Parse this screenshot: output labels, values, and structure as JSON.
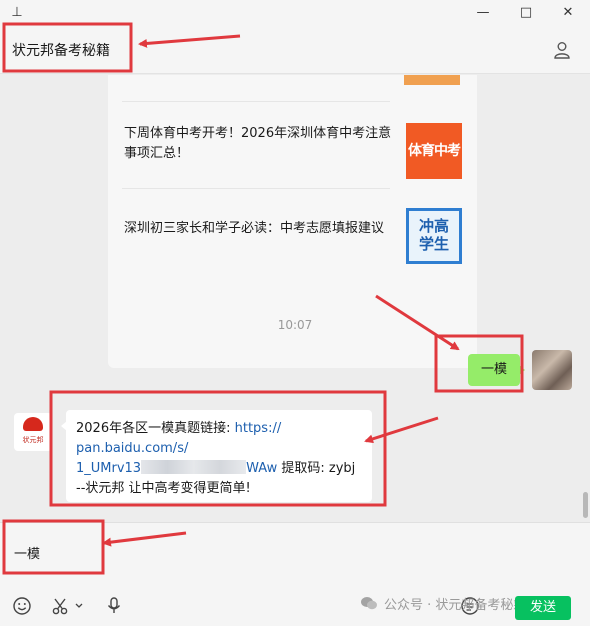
{
  "window": {
    "pin_glyph": "⊥",
    "min_glyph": "—",
    "max_glyph": "□",
    "close_glyph": "✕"
  },
  "header": {
    "title": "状元邦备考秘籍"
  },
  "card": {
    "items": [
      {
        "title": "下周体育中考开考！2026年深圳体育中考注意事项汇总！",
        "thumb_text": "体育中考"
      },
      {
        "title": "深圳初三家长和学子必读：中考志愿填报建议",
        "thumb_line1": "冲高",
        "thumb_line2": "学生"
      }
    ]
  },
  "timestamp": "10:07",
  "outgoing_message": "一模",
  "incoming_message": {
    "line1_prefix": "2026年各区一模真题链接: ",
    "link_a": "https://",
    "link_b": "pan.baidu.com/s/",
    "link_c_start": "1_UMrv13",
    "link_c_end": "WAw",
    "code_text": " 提取码: zybj",
    "signature": "--状元邦 让中高考变得更简单!",
    "avatar_name": "状元邦"
  },
  "input": {
    "value": "一模",
    "send_label": "发送"
  },
  "watermark": "公众号 · 状元邦备考秘籍",
  "colors": {
    "annotation_red": "#e0393e",
    "bubble_green": "#95ec69",
    "send_green": "#07c160",
    "link_blue": "#1d5fae"
  }
}
